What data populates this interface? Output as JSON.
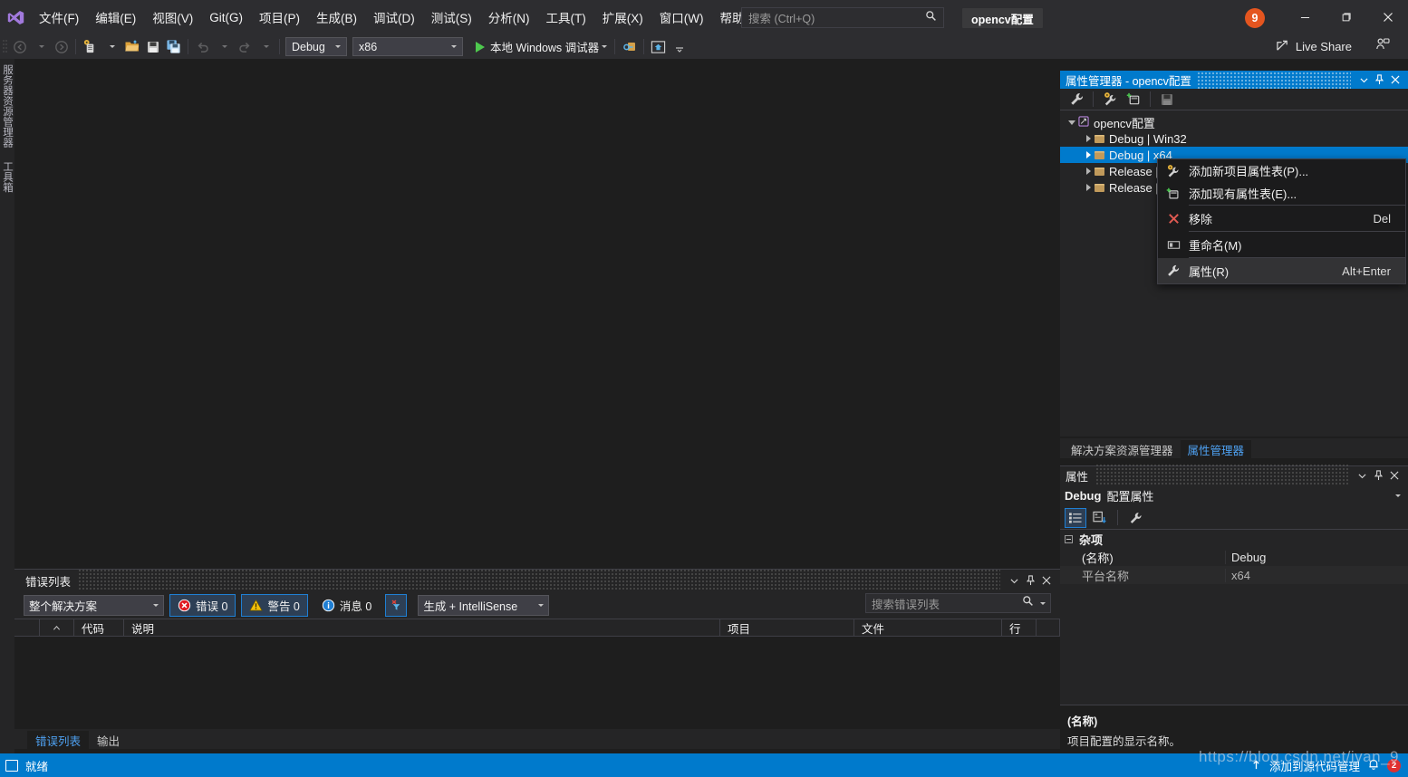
{
  "titlebar": {
    "logo_icon": "visual-studio-logo",
    "menu": [
      "文件(F)",
      "编辑(E)",
      "视图(V)",
      "Git(G)",
      "项目(P)",
      "生成(B)",
      "调试(D)",
      "测试(S)",
      "分析(N)",
      "工具(T)",
      "扩展(X)",
      "窗口(W)",
      "帮助(H)"
    ],
    "search_placeholder": "搜索 (Ctrl+Q)",
    "search_icon": "search-icon",
    "project_chip": "opencv配置",
    "notification_count": "9",
    "minimize_icon": "minimize-icon",
    "maximize_icon": "maximize-icon",
    "close_icon": "close-icon"
  },
  "toolbar": {
    "back_icon": "navigate-back-icon",
    "forward_icon": "navigate-forward-icon",
    "new_project_icon": "new-project-icon",
    "open_file_icon": "open-file-icon",
    "save_icon": "save-icon",
    "save_all_icon": "save-all-icon",
    "undo_icon": "undo-icon",
    "redo_icon": "redo-icon",
    "configuration": "Debug",
    "platform": "x86",
    "run_label": "本地 Windows 调试器",
    "run_icon": "play-icon",
    "attach_icon": "attach-process-icon",
    "home_icon": "home-icon",
    "overflow_icon": "toolbar-overflow-icon",
    "live_share_label": "Live Share",
    "live_share_icon": "live-share-icon",
    "feedback_icon": "feedback-icon"
  },
  "left_rail": {
    "tabs": [
      "服务器资源管理器",
      "工具箱"
    ]
  },
  "error_list": {
    "title": "错误列表",
    "scope": "整个解决方案",
    "errors_label": "错误 0",
    "warnings_label": "警告 0",
    "messages_label": "消息 0",
    "error_icon": "error-circle-icon",
    "warning_icon": "warning-triangle-icon",
    "info_icon": "info-circle-icon",
    "filter_icon": "clear-filter-icon",
    "build_filter": "生成 + IntelliSense",
    "search_placeholder": "搜索错误列表",
    "search_icon": "search-icon",
    "columns": [
      "",
      "",
      "代码",
      "说明",
      "项目",
      "文件",
      "行"
    ],
    "rows": [],
    "dropdown_icon": "chevron-down-icon",
    "pin_icon": "pin-icon",
    "close_icon": "close-icon"
  },
  "bottom_tabs": {
    "tabs": [
      {
        "label": "错误列表",
        "active": true
      },
      {
        "label": "输出",
        "active": false
      }
    ]
  },
  "property_manager": {
    "title": "属性管理器 - opencv配置",
    "dropdown_icon": "chevron-down-icon",
    "pin_icon": "pin-icon",
    "close_icon": "close-icon",
    "toolbar_icons": [
      "properties-wrench-icon",
      "add-new-project-property-sheet-icon",
      "add-existing-property-sheet-icon",
      "save-icon"
    ],
    "tree": {
      "root": "opencv配置",
      "root_icon": "solution-icon",
      "children": [
        {
          "label": "Debug | Win32",
          "selected": false
        },
        {
          "label": "Debug | x64",
          "selected": true
        },
        {
          "label": "Release | ",
          "selected": false
        },
        {
          "label": "Release | ",
          "selected": false
        }
      ]
    }
  },
  "context_menu": {
    "items": [
      {
        "label": "添加新项目属性表(P)...",
        "shortcut": "",
        "icon": "add-new-property-sheet-icon",
        "highlighted": false
      },
      {
        "label": "添加现有属性表(E)...",
        "shortcut": "",
        "icon": "add-existing-property-sheet-icon",
        "highlighted": false
      },
      {
        "label": "移除",
        "shortcut": "Del",
        "icon": "remove-x-icon",
        "highlighted": false,
        "separator_before": true
      },
      {
        "label": "重命名(M)",
        "shortcut": "",
        "icon": "rename-icon",
        "highlighted": false,
        "separator_before": true
      },
      {
        "label": "属性(R)",
        "shortcut": "Alt+Enter",
        "icon": "properties-wrench-icon",
        "highlighted": true,
        "separator_before": true
      }
    ]
  },
  "panel_tabs": {
    "tabs": [
      {
        "label": "解决方案资源管理器",
        "active": false
      },
      {
        "label": "属性管理器",
        "active": true
      }
    ]
  },
  "properties": {
    "title": "属性",
    "dropdown_icon": "chevron-down-icon",
    "pin_icon": "pin-icon",
    "close_icon": "close-icon",
    "object_name": "Debug",
    "object_type": "配置属性",
    "object_dropdown_icon": "chevron-down-icon",
    "toolbar_icons": [
      "categorized-icon",
      "alphabetical-icon",
      "property-pages-icon"
    ],
    "category": "杂项",
    "rows": [
      {
        "key": "(名称)",
        "value": "Debug"
      },
      {
        "key": "平台名称",
        "value": "x64"
      }
    ],
    "description_title": "(名称)",
    "description_body": "项目配置的显示名称。"
  },
  "status_bar": {
    "ready_icon": "ready-icon",
    "ready_label": "就绪",
    "source_control_label": "添加到源代码管理",
    "source_control_icon": "source-control-icon",
    "notification_icon": "notification-bell-icon",
    "notification_count": "2"
  },
  "watermark": {
    "text": "https://blog.csdn.net/ivan_9"
  },
  "colors": {
    "accent": "#007acc",
    "chrome": "#2d2d30",
    "panel": "#252526",
    "editor": "#1e1e1e",
    "link": "#4ea0f0",
    "badge": "#e4551f"
  }
}
